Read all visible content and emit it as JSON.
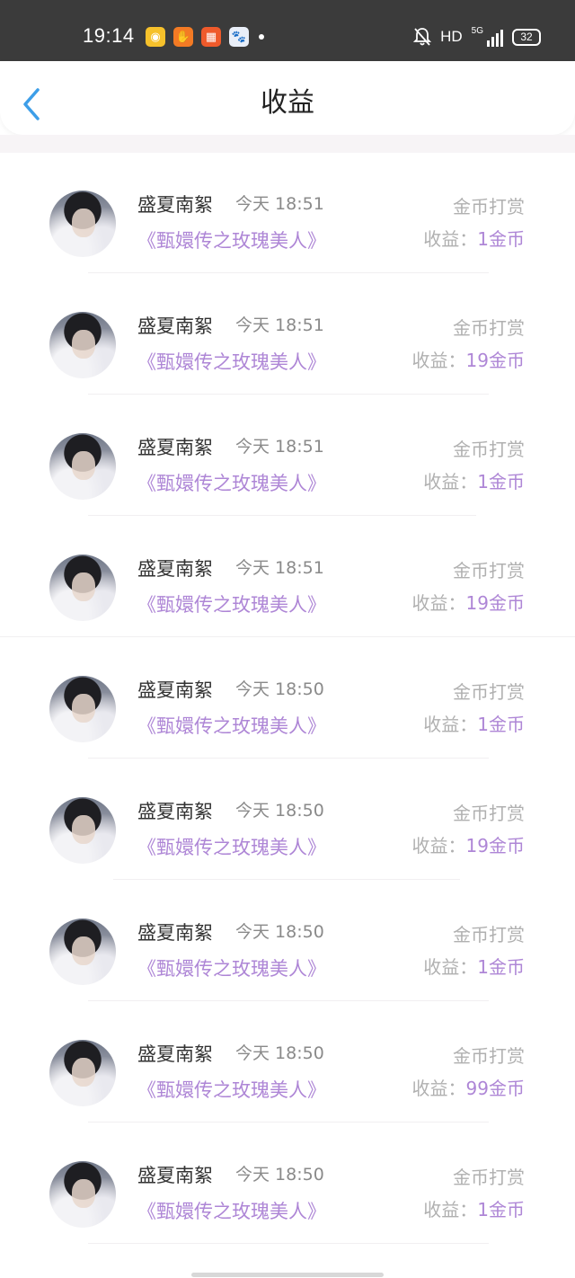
{
  "status_bar": {
    "time": "19:14",
    "hd": "HD",
    "network": "5G",
    "battery": "32",
    "app_icons": [
      "weibo-icon",
      "hand-icon",
      "grid-app-icon",
      "baidu-icon"
    ]
  },
  "nav": {
    "back_icon": "chevron-left-icon",
    "title": "收益"
  },
  "list": {
    "income_label": "收益：",
    "items": [
      {
        "name": "盛夏南絮",
        "time": "今天 18:51",
        "book": "《甄嬛传之玫瑰美人》",
        "type": "金币打赏",
        "amount": "1金币"
      },
      {
        "name": "盛夏南絮",
        "time": "今天 18:51",
        "book": "《甄嬛传之玫瑰美人》",
        "type": "金币打赏",
        "amount": "19金币"
      },
      {
        "name": "盛夏南絮",
        "time": "今天 18:51",
        "book": "《甄嬛传之玫瑰美人》",
        "type": "金币打赏",
        "amount": "1金币"
      },
      {
        "name": "盛夏南絮",
        "time": "今天 18:51",
        "book": "《甄嬛传之玫瑰美人》",
        "type": "金币打赏",
        "amount": "19金币"
      },
      {
        "name": "盛夏南絮",
        "time": "今天 18:50",
        "book": "《甄嬛传之玫瑰美人》",
        "type": "金币打赏",
        "amount": "1金币"
      },
      {
        "name": "盛夏南絮",
        "time": "今天 18:50",
        "book": "《甄嬛传之玫瑰美人》",
        "type": "金币打赏",
        "amount": "19金币"
      },
      {
        "name": "盛夏南絮",
        "time": "今天 18:50",
        "book": "《甄嬛传之玫瑰美人》",
        "type": "金币打赏",
        "amount": "1金币"
      },
      {
        "name": "盛夏南絮",
        "time": "今天 18:50",
        "book": "《甄嬛传之玫瑰美人》",
        "type": "金币打赏",
        "amount": "99金币"
      },
      {
        "name": "盛夏南絮",
        "time": "今天 18:50",
        "book": "《甄嬛传之玫瑰美人》",
        "type": "金币打赏",
        "amount": "1金币"
      }
    ]
  },
  "colors": {
    "accent_purple": "#ae86d6",
    "back_blue": "#3d9ee8",
    "status_bar_bg": "#3b3b3b"
  }
}
